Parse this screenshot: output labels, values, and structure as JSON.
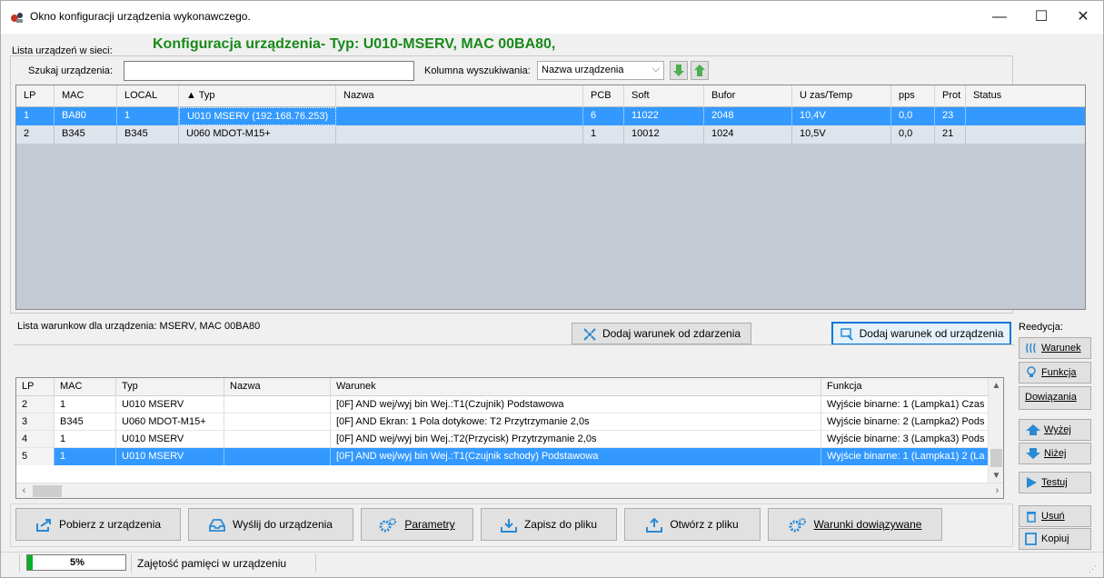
{
  "window": {
    "title": "Okno konfiguracji urządzenia wykonawczego.",
    "controls": {
      "minimize": "—",
      "maximize": "☐",
      "close": "✕"
    }
  },
  "header": {
    "network_list_label": "Lista urządzeń w sieci:",
    "config_title": "Konfiguracja urządzenia- Typ: U010-MSERV, MAC 00BA80,"
  },
  "search": {
    "label": "Szukaj urządzenia:",
    "value": "",
    "column_label": "Kolumna wyszukiwania:",
    "column_selected": "Nazwa urządzenia"
  },
  "devices": {
    "columns": [
      "LP",
      "MAC",
      "LOCAL",
      "▲ Typ",
      "Nazwa",
      "PCB",
      "Soft",
      "Bufor",
      "U zas/Temp",
      "pps",
      "Prot",
      "Status"
    ],
    "rows": [
      [
        "1",
        "BA80",
        "1",
        "U010 MSERV (192.168.76.253)",
        "",
        "6",
        "11022",
        "2048",
        "10,4V",
        "0,0",
        "23",
        ""
      ],
      [
        "2",
        "B345",
        "B345",
        "U060 MDOT-M15+",
        "",
        "1",
        "10012",
        "1024",
        "10,5V",
        "0,0",
        "21",
        ""
      ]
    ]
  },
  "conditions": {
    "label": "Lista warunkow dla urządzenia: MSERV, MAC 00BA80",
    "add_from_event": "Dodaj warunek od zdarzenia",
    "add_from_device": "Dodaj warunek od urządzenia",
    "columns": [
      "LP",
      "MAC",
      "Typ",
      "Nazwa",
      "Warunek",
      "Funkcja"
    ],
    "rows": [
      [
        "2",
        "1",
        "U010 MSERV",
        "",
        "[0F] AND  wej/wyj bin Wej.:T1(Czujnik)  Podstawowa",
        "Wyjście binarne:  1 (Lampka1)  Czas"
      ],
      [
        "3",
        "B345",
        "U060 MDOT-M15+",
        "",
        "[0F] AND  Ekran: 1 Pola dotykowe: T2  Przytrzymanie 2,0s",
        "Wyjście binarne:  2 (Lampka2)  Pods"
      ],
      [
        "4",
        "1",
        "U010 MSERV",
        "",
        "[0F] AND  wej/wyj bin Wej.:T2(Przycisk)  Przytrzymanie 2,0s",
        "Wyjście binarne:  3 (Lampka3)  Pods"
      ],
      [
        "5",
        "1",
        "U010 MSERV",
        "",
        "[0F] AND  wej/wyj bin Wej.:T1(Czujnik schody)  Podstawowa",
        "Wyjście binarne:  1 (Lampka1) 2 (La"
      ]
    ]
  },
  "side": {
    "title": "Reedycja:",
    "warunek": "Warunek",
    "funkcja": "Funkcja",
    "dowiazania": "Dowiązania",
    "wyzej": "Wyżej",
    "nizej": "Niżej",
    "testuj": "Testuj",
    "usun": "Usuń",
    "kopiuj": "Kopiuj"
  },
  "toolbar": {
    "pobierz": "Pobierz z urządzenia",
    "wyslij": "Wyślij do urządzenia",
    "parametry": "Parametry",
    "zapisz": "Zapisz do pliku",
    "otworz": "Otwórz z pliku",
    "warunki": "Warunki dowiązywane"
  },
  "status": {
    "memory_percent": "5%",
    "memory_fraction": 0.05,
    "memory_label": "Zajętość pamięci w urządzeniu"
  },
  "colors": {
    "title_green": "#1a8a1a",
    "selection": "#3399ff",
    "progress": "#06b025",
    "accent_blue": "#0078d7"
  }
}
